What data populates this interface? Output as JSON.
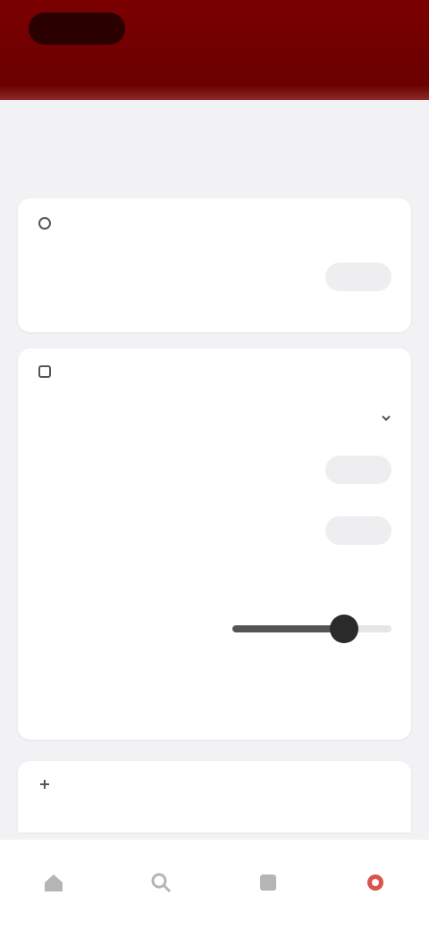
{
  "appbar": {
    "logo_text": "",
    "action_label": ""
  },
  "page": {
    "title": ""
  },
  "sections": {
    "first": {
      "heading": "",
      "row_label": "",
      "row_value": ""
    },
    "second": {
      "heading": "",
      "select_label": "",
      "select_value": "",
      "row2_label": "",
      "row2_value": "",
      "row3_label": "",
      "row3_value": "",
      "slider_label": "",
      "slider_min": "",
      "slider_max": "",
      "slider_fraction": 0.7,
      "last_label": "",
      "last_value": ""
    },
    "third": {
      "heading": ""
    }
  },
  "nav": {
    "items": [
      {
        "label": "",
        "icon": "home-icon"
      },
      {
        "label": "",
        "icon": "search-icon"
      },
      {
        "label": "",
        "icon": "list-icon"
      },
      {
        "label": "",
        "icon": "gear-icon",
        "active": true
      }
    ]
  },
  "colors": {
    "brand": "#6b0000",
    "accent": "#d9534f"
  }
}
